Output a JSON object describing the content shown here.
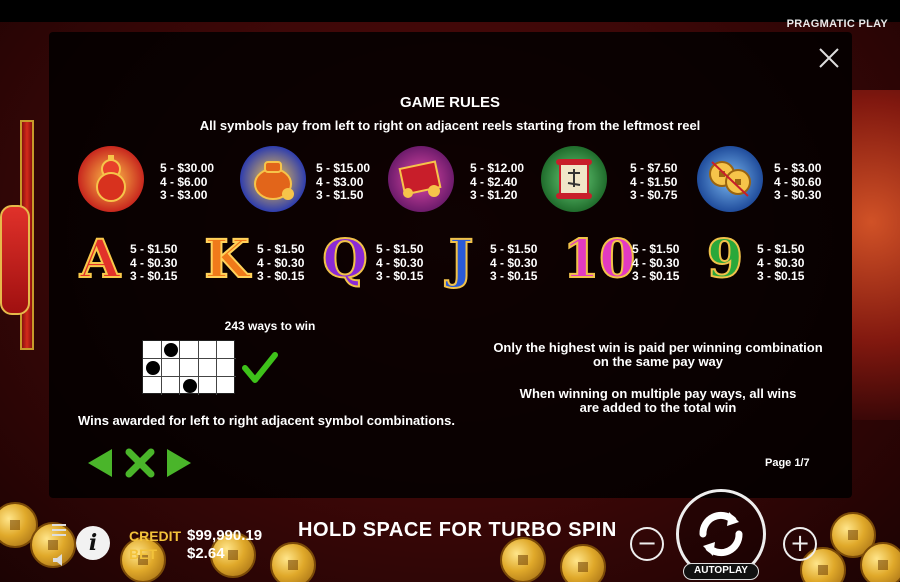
{
  "brand": "PRAGMATIC PLAY",
  "rules": {
    "title": "GAME RULES",
    "subtitle": "All symbols pay from left to right on adjacent reels starting from the leftmost reel"
  },
  "symbols_row1": [
    {
      "name": "gourd",
      "color": "#c8281e",
      "pays": [
        "5 - $30.00",
        "4 - $6.00",
        "3 - $3.00"
      ]
    },
    {
      "name": "money-bag",
      "color": "#d86a1a",
      "pays": [
        "5 - $15.00",
        "4 - $3.00",
        "3 - $1.50"
      ]
    },
    {
      "name": "red-envelope",
      "color": "#b01e3a",
      "pays": [
        "5 - $12.00",
        "4 - $2.40",
        "3 - $1.20"
      ]
    },
    {
      "name": "scroll",
      "color": "#2e7a3a",
      "pays": [
        "5 - $7.50",
        "4 - $1.50",
        "3 - $0.75"
      ]
    },
    {
      "name": "coins",
      "color": "#d8a42a",
      "pays": [
        "5 - $3.00",
        "4 - $0.60",
        "3 - $0.30"
      ]
    }
  ],
  "symbols_row2": [
    {
      "letter": "A",
      "pays": [
        "5 - $1.50",
        "4 - $0.30",
        "3 - $0.15"
      ]
    },
    {
      "letter": "K",
      "pays": [
        "5 - $1.50",
        "4 - $0.30",
        "3 - $0.15"
      ]
    },
    {
      "letter": "Q",
      "pays": [
        "5 - $1.50",
        "4 - $0.30",
        "3 - $0.15"
      ]
    },
    {
      "letter": "J",
      "pays": [
        "5 - $1.50",
        "4 - $0.30",
        "3 - $0.15"
      ]
    },
    {
      "letter": "10",
      "pays": [
        "5 - $1.50",
        "4 - $0.30",
        "3 - $0.15"
      ]
    },
    {
      "letter": "9",
      "pays": [
        "5 - $1.50",
        "4 - $0.30",
        "3 - $0.15"
      ]
    }
  ],
  "ways": {
    "label": "243 ways to win",
    "wins_text": "Wins awarded for left to right adjacent symbol combinations."
  },
  "notes": {
    "highest_win_line1": "Only the highest win is paid per winning combination",
    "highest_win_line2": "on the same pay way",
    "multiple_line1": "When winning on multiple pay ways, all wins",
    "multiple_line2": "are added to the total win"
  },
  "pagination": {
    "page": "Page 1/7"
  },
  "bottom_bar": {
    "credit_label": "CREDIT",
    "credit_value": "$99,990.19",
    "bet_label": "BET",
    "bet_value": "$2.64",
    "turbo_hint": "HOLD SPACE FOR TURBO SPIN",
    "minus": "−",
    "plus": "+",
    "autoplay": "AUTOPLAY",
    "info": "i"
  },
  "colors": {
    "accent_gold": "#f2c23a",
    "nav_green": "#4ab52a",
    "check_green": "#3ec21a"
  }
}
